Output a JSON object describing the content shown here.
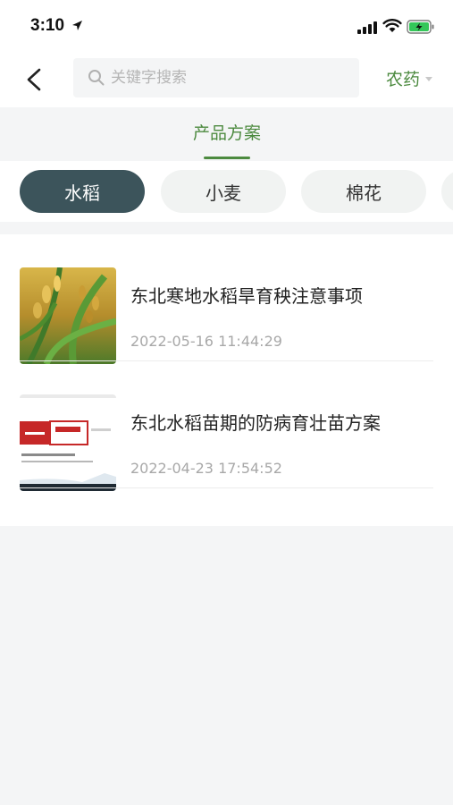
{
  "status_bar": {
    "time": "3:10"
  },
  "header": {
    "search_placeholder": "关键字搜索",
    "category_label": "农药"
  },
  "tabs": [
    {
      "label": "产品方案",
      "active": true
    }
  ],
  "crops": [
    {
      "label": "水稻",
      "active": true
    },
    {
      "label": "小麦",
      "active": false
    },
    {
      "label": "棉花",
      "active": false
    }
  ],
  "articles": [
    {
      "title": "东北寒地水稻旱育秧注意事项",
      "date": "2022-05-16 11:44:29",
      "thumbnail": "rice-plant-photo"
    },
    {
      "title": "东北水稻苗期的防病育壮苗方案",
      "date": "2022-04-23 17:54:52",
      "thumbnail": "product-poster-image"
    }
  ],
  "colors": {
    "accent": "#4c8a3f",
    "chip_active": "#3c545b",
    "background": "#f4f5f6"
  }
}
